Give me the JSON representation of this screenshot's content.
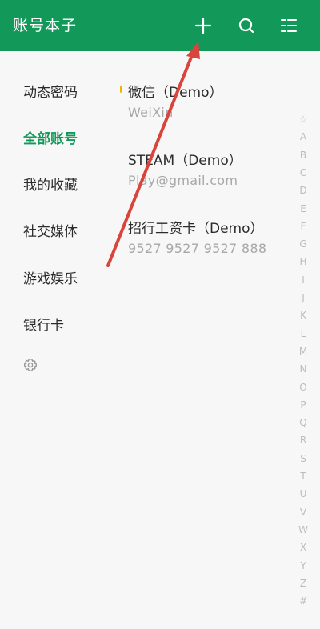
{
  "app": {
    "title": "账号本子"
  },
  "toolbar": {
    "add_icon": "plus-icon",
    "search_icon": "search-icon",
    "menu_icon": "list-menu-icon"
  },
  "sidebar": {
    "items": [
      {
        "label": "动态密码",
        "active": false
      },
      {
        "label": "全部账号",
        "active": true
      },
      {
        "label": "我的收藏",
        "active": false
      },
      {
        "label": "社交媒体",
        "active": false
      },
      {
        "label": "游戏娱乐",
        "active": false
      },
      {
        "label": "银行卡",
        "active": false
      }
    ],
    "settings_icon": "gear-icon"
  },
  "accounts": [
    {
      "name": "微信（Demo）",
      "detail": "WeiXin",
      "pinned": true
    },
    {
      "name": "STEAM（Demo）",
      "detail": "Play@gmail.com",
      "pinned": false
    },
    {
      "name": "招行工资卡（Demo）",
      "detail": "9527  9527  9527  888",
      "pinned": false
    }
  ],
  "index_bar": [
    "☆",
    "A",
    "B",
    "C",
    "D",
    "E",
    "F",
    "G",
    "H",
    "I",
    "J",
    "K",
    "L",
    "M",
    "N",
    "O",
    "P",
    "Q",
    "R",
    "S",
    "T",
    "U",
    "V",
    "W",
    "X",
    "Y",
    "Z",
    "#"
  ],
  "colors": {
    "brand": "#12995a",
    "annotation_arrow": "#d9443d",
    "pin": "#f2b400"
  }
}
